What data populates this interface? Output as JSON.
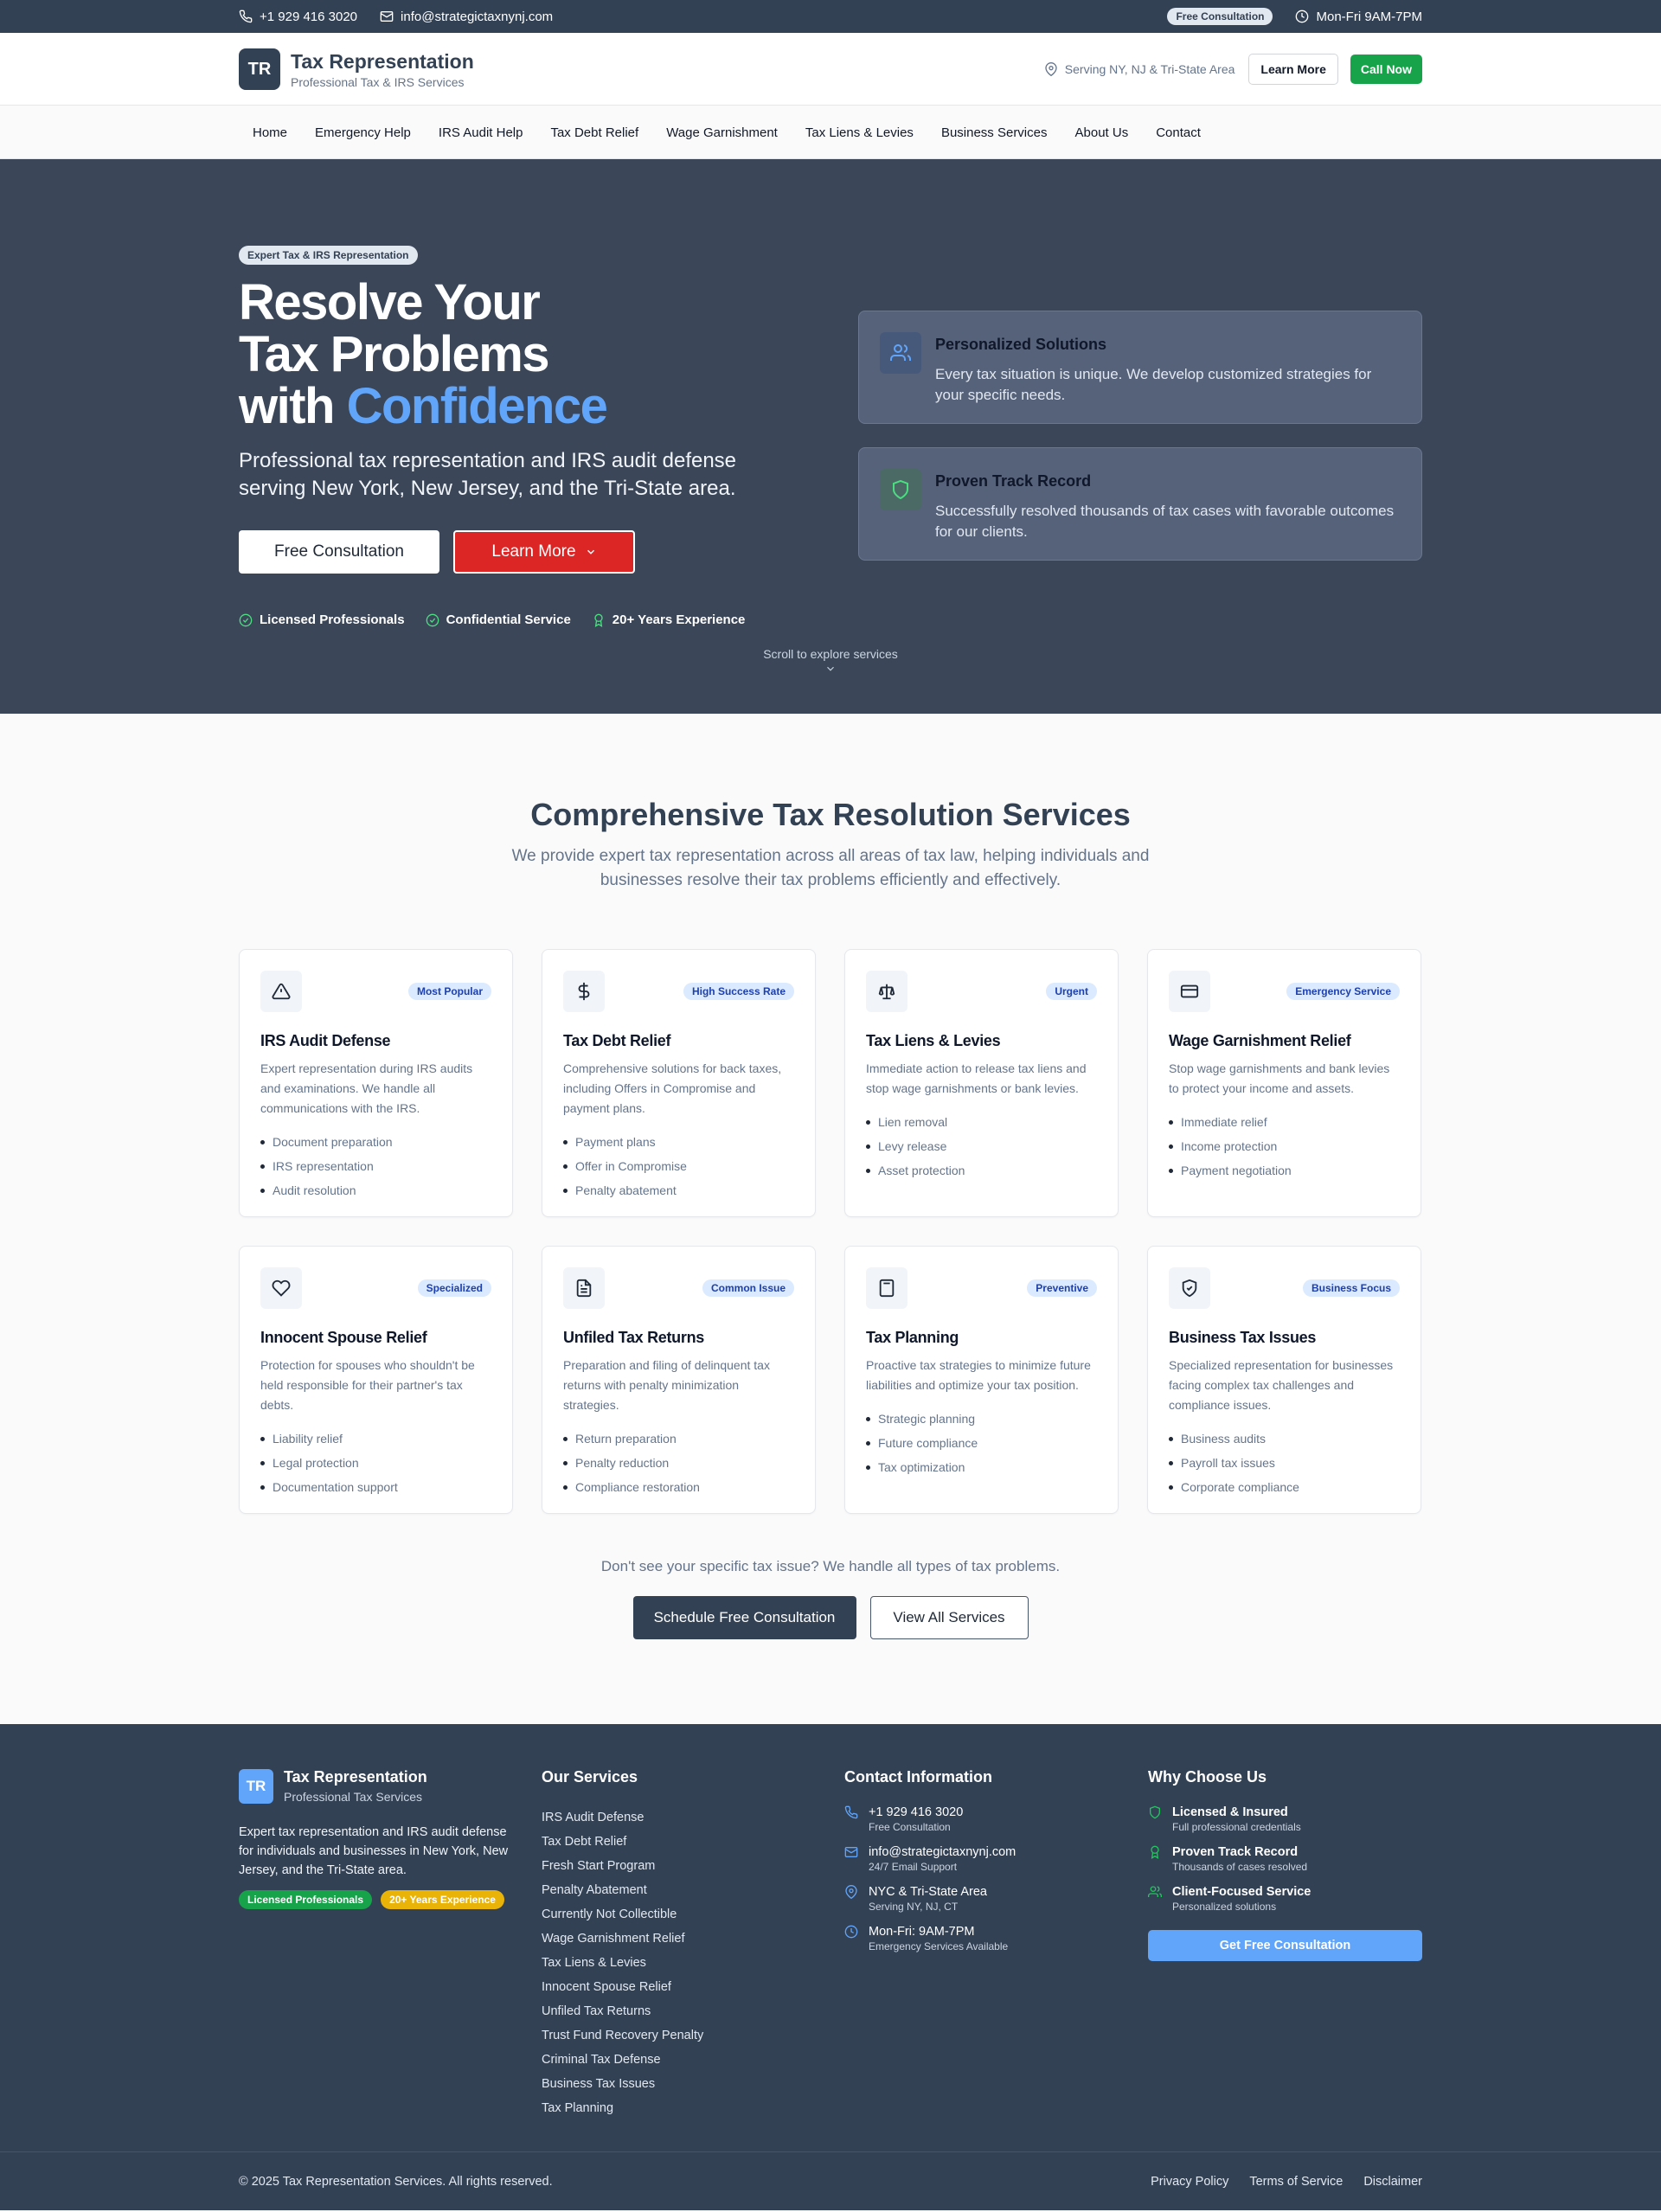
{
  "topbar": {
    "phone": "+1 929 416 3020",
    "email": "info@strategictaxnynj.com",
    "badge": "Free Consultation",
    "hours": "Mon-Fri 9AM-7PM"
  },
  "header": {
    "logo": "TR",
    "title": "Tax Representation",
    "subtitle": "Professional Tax & IRS Services",
    "serving": "Serving NY, NJ & Tri-State Area",
    "learn_more": "Learn More",
    "call_now": "Call Now"
  },
  "nav": [
    "Home",
    "Emergency Help",
    "IRS Audit Help",
    "Tax Debt Relief",
    "Wage Garnishment",
    "Tax Liens & Levies",
    "Business Services",
    "About Us",
    "Contact"
  ],
  "hero": {
    "badge": "Expert Tax & IRS Representation",
    "title_line1": "Resolve Your",
    "title_line2": "Tax Problems",
    "title_line3a": "with ",
    "title_line3b": "Confidence",
    "subtitle": "Professional tax representation and IRS audit defense serving New York, New Jersey, and the Tri-State area.",
    "btn_primary": "Free Consultation",
    "btn_secondary": "Learn More",
    "trust": [
      "Licensed Professionals",
      "Confidential Service",
      "20+ Years Experience"
    ],
    "scroll_hint": "Scroll to explore services",
    "features": [
      {
        "title": "Personalized Solutions",
        "text": "Every tax situation is unique. We develop customized strategies for your specific needs.",
        "icon": "users-icon"
      },
      {
        "title": "Proven Track Record",
        "text": "Successfully resolved thousands of tax cases with favorable outcomes for our clients.",
        "icon": "shield-icon"
      }
    ]
  },
  "services": {
    "title": "Comprehensive Tax Resolution Services",
    "subtitle_line1": "We provide expert tax representation across all areas of tax law, helping individuals and",
    "subtitle_line2": "businesses resolve their tax problems efficiently and effectively.",
    "cards": [
      {
        "title": "IRS Audit Defense",
        "badge": "Most Popular",
        "icon": "alert-triangle-icon",
        "desc": "Expert representation during IRS audits and examinations. We handle all communications with the IRS.",
        "items": [
          "Document preparation",
          "IRS representation",
          "Audit resolution"
        ]
      },
      {
        "title": "Tax Debt Relief",
        "badge": "High Success Rate",
        "icon": "dollar-icon",
        "desc": "Comprehensive solutions for back taxes, including Offers in Compromise and payment plans.",
        "items": [
          "Payment plans",
          "Offer in Compromise",
          "Penalty abatement"
        ]
      },
      {
        "title": "Tax Liens & Levies",
        "badge": "Urgent",
        "icon": "scale-icon",
        "desc": "Immediate action to release tax liens and stop wage garnishments or bank levies.",
        "items": [
          "Lien removal",
          "Levy release",
          "Asset protection"
        ]
      },
      {
        "title": "Wage Garnishment Relief",
        "badge": "Emergency Service",
        "icon": "credit-card-icon",
        "desc": "Stop wage garnishments and bank levies to protect your income and assets.",
        "items": [
          "Immediate relief",
          "Income protection",
          "Payment negotiation"
        ]
      },
      {
        "title": "Innocent Spouse Relief",
        "badge": "Specialized",
        "icon": "heart-icon",
        "desc": "Protection for spouses who shouldn't be held responsible for their partner's tax debts.",
        "items": [
          "Liability relief",
          "Legal protection",
          "Documentation support"
        ]
      },
      {
        "title": "Unfiled Tax Returns",
        "badge": "Common Issue",
        "icon": "file-icon",
        "desc": "Preparation and filing of delinquent tax returns with penalty minimization strategies.",
        "items": [
          "Return preparation",
          "Penalty reduction",
          "Compliance restoration"
        ]
      },
      {
        "title": "Tax Planning",
        "badge": "Preventive",
        "icon": "calculator-icon",
        "desc": "Proactive tax strategies to minimize future liabilities and optimize your tax position.",
        "items": [
          "Strategic planning",
          "Future compliance",
          "Tax optimization"
        ]
      },
      {
        "title": "Business Tax Issues",
        "badge": "Business Focus",
        "icon": "shield-check-icon",
        "desc": "Specialized representation for businesses facing complex tax challenges and compliance issues.",
        "items": [
          "Business audits",
          "Payroll tax issues",
          "Corporate compliance"
        ]
      }
    ],
    "note": "Don't see your specific tax issue? We handle all types of tax problems.",
    "btn_schedule": "Schedule Free Consultation",
    "btn_view": "View All Services"
  },
  "footer": {
    "logo": "TR",
    "brand": "Tax Representation",
    "brand_sub": "Professional Tax Services",
    "desc": "Expert tax representation and IRS audit defense for individuals and businesses in New York, New Jersey, and the Tri-State area.",
    "badge_green": "Licensed Professionals",
    "badge_yellow": "20+ Years Experience",
    "services_title": "Our Services",
    "services": [
      "IRS Audit Defense",
      "Tax Debt Relief",
      "Fresh Start Program",
      "Penalty Abatement",
      "Currently Not Collectible",
      "Wage Garnishment Relief",
      "Tax Liens & Levies",
      "Innocent Spouse Relief",
      "Unfiled Tax Returns",
      "Trust Fund Recovery Penalty",
      "Criminal Tax Defense",
      "Business Tax Issues",
      "Tax Planning"
    ],
    "contact_title": "Contact Information",
    "contact": [
      {
        "title": "+1 929 416 3020",
        "sub": "Free Consultation",
        "icon": "phone-icon"
      },
      {
        "title": "info@strategictaxnynj.com",
        "sub": "24/7 Email Support",
        "icon": "mail-icon"
      },
      {
        "title": "NYC & Tri-State Area",
        "sub": "Serving NY, NJ, CT",
        "icon": "map-pin-icon"
      },
      {
        "title": "Mon-Fri: 9AM-7PM",
        "sub": "Emergency Services Available",
        "icon": "clock-icon"
      }
    ],
    "why_title": "Why Choose Us",
    "why": [
      {
        "title": "Licensed & Insured",
        "sub": "Full professional credentials",
        "icon": "shield-icon"
      },
      {
        "title": "Proven Track Record",
        "sub": "Thousands of cases resolved",
        "icon": "award-icon"
      },
      {
        "title": "Client-Focused Service",
        "sub": "Personalized solutions",
        "icon": "users-icon"
      }
    ],
    "cta": "Get Free Consultation",
    "copyright": "© 2025 Tax Representation Services. All rights reserved.",
    "legal": [
      "Privacy Policy",
      "Terms of Service",
      "Disclaimer"
    ]
  }
}
